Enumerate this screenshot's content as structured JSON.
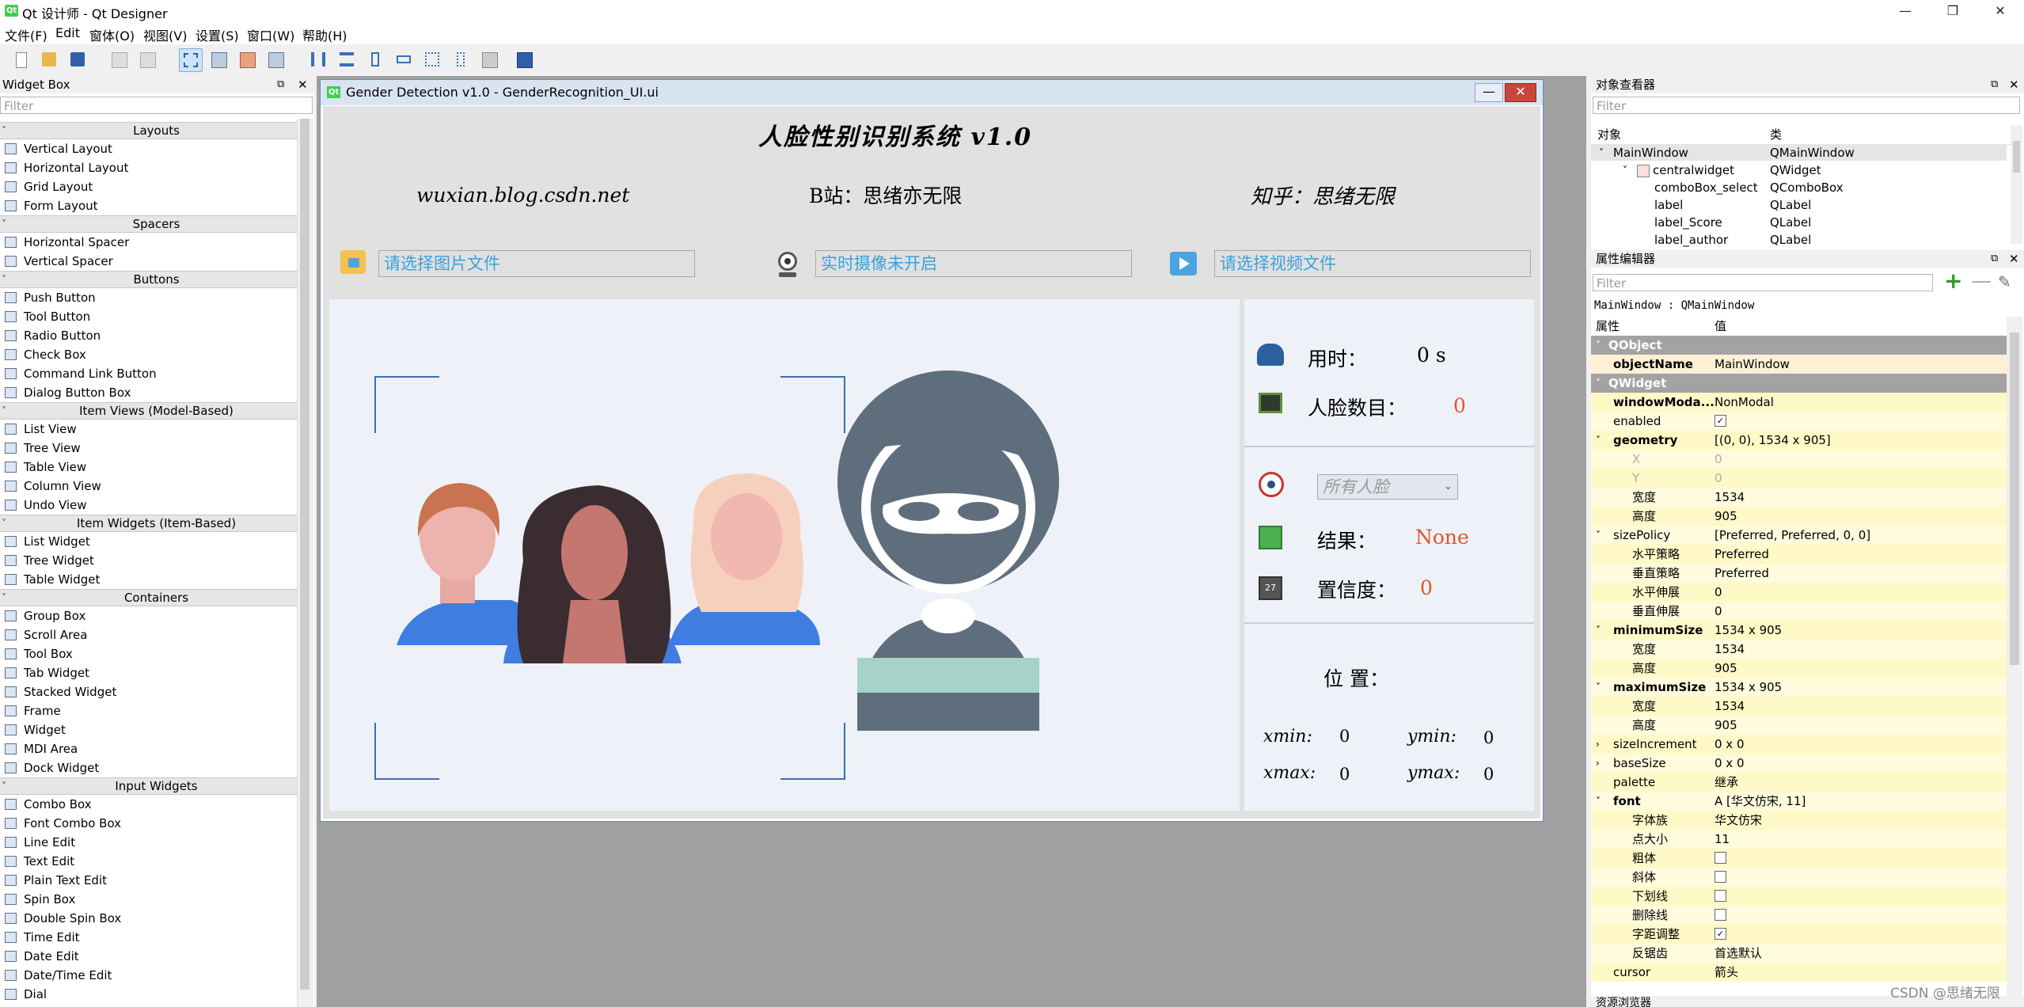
{
  "window": {
    "title": "Qt 设计师 - Qt Designer",
    "app_icon": "Qt"
  },
  "menu": [
    "文件(F)",
    "Edit",
    "窗体(O)",
    "视图(V)",
    "设置(S)",
    "窗口(W)",
    "帮助(H)"
  ],
  "widget_box": {
    "title": "Widget Box",
    "filter_placeholder": "Filter",
    "categories": {
      "layouts": {
        "label": "Layouts",
        "items": [
          "Vertical Layout",
          "Horizontal Layout",
          "Grid Layout",
          "Form Layout"
        ]
      },
      "spacers": {
        "label": "Spacers",
        "items": [
          "Horizontal Spacer",
          "Vertical Spacer"
        ]
      },
      "buttons": {
        "label": "Buttons",
        "items": [
          "Push Button",
          "Tool Button",
          "Radio Button",
          "Check Box",
          "Command Link Button",
          "Dialog Button Box"
        ]
      },
      "item_views": {
        "label": "Item Views (Model-Based)",
        "items": [
          "List View",
          "Tree View",
          "Table View",
          "Column View",
          "Undo View"
        ]
      },
      "item_widgets": {
        "label": "Item Widgets (Item-Based)",
        "items": [
          "List Widget",
          "Tree Widget",
          "Table Widget"
        ]
      },
      "containers": {
        "label": "Containers",
        "items": [
          "Group Box",
          "Scroll Area",
          "Tool Box",
          "Tab Widget",
          "Stacked Widget",
          "Frame",
          "Widget",
          "MDI Area",
          "Dock Widget"
        ]
      },
      "input_widgets": {
        "label": "Input Widgets",
        "items": [
          "Combo Box",
          "Font Combo Box",
          "Line Edit",
          "Text Edit",
          "Plain Text Edit",
          "Spin Box",
          "Double Spin Box",
          "Time Edit",
          "Date Edit",
          "Date/Time Edit",
          "Dial"
        ]
      }
    }
  },
  "form": {
    "window_title": "Gender Detection v1.0 - GenderRecognition_UI.ui",
    "heading": "人脸性别识别系统  v1.0",
    "blog": "wuxian.blog.csdn.net",
    "bilibili": "B站：思绪亦无限",
    "zhihu": "知乎：思绪无限",
    "image_input": "请选择图片文件",
    "camera_input": "实时摄像未开启",
    "video_input": "请选择视频文件",
    "time_label": "用时：",
    "time_value": "0 s",
    "faces_label": "人脸数目：",
    "faces_value": "0",
    "combo_value": "所有人脸",
    "result_label": "结果：",
    "result_value": "None",
    "confidence_label": "置信度：",
    "confidence_value": "0",
    "position_label": "位 置：",
    "xmin_label": "xmin:",
    "xmin_value": "0",
    "ymin_label": "ymin:",
    "ymin_value": "0",
    "xmax_label": "xmax:",
    "xmax_value": "0",
    "ymax_label": "ymax:",
    "ymax_value": "0"
  },
  "object_inspector": {
    "title": "对象查看器",
    "filter_placeholder": "Filter",
    "col_object": "对象",
    "col_class": "类",
    "rows": [
      {
        "name": "MainWindow",
        "cls": "QMainWindow"
      },
      {
        "name": "centralwidget",
        "cls": "QWidget"
      },
      {
        "name": "comboBox_select",
        "cls": "QComboBox"
      },
      {
        "name": "label",
        "cls": "QLabel"
      },
      {
        "name": "label_Score",
        "cls": "QLabel"
      },
      {
        "name": "label_author",
        "cls": "QLabel"
      }
    ]
  },
  "property_editor": {
    "title": "属性编辑器",
    "filter_placeholder": "Filter",
    "context": "MainWindow : QMainWindow",
    "col_prop": "属性",
    "col_value": "值",
    "rows": [
      {
        "k": "QObject",
        "v": ""
      },
      {
        "k": "objectName",
        "v": "MainWindow"
      },
      {
        "k": "QWidget",
        "v": ""
      },
      {
        "k": "windowModa...",
        "v": "NonModal"
      },
      {
        "k": "enabled",
        "v": "✓"
      },
      {
        "k": "geometry",
        "v": "[(0, 0), 1534 x 905]"
      },
      {
        "k": "X",
        "v": "0"
      },
      {
        "k": "Y",
        "v": "0"
      },
      {
        "k": "宽度",
        "v": "1534"
      },
      {
        "k": "高度",
        "v": "905"
      },
      {
        "k": "sizePolicy",
        "v": "[Preferred, Preferred, 0, 0]"
      },
      {
        "k": "水平策略",
        "v": "Preferred"
      },
      {
        "k": "垂直策略",
        "v": "Preferred"
      },
      {
        "k": "水平伸展",
        "v": "0"
      },
      {
        "k": "垂直伸展",
        "v": "0"
      },
      {
        "k": "minimumSize",
        "v": "1534 x 905"
      },
      {
        "k": "宽度",
        "v": "1534"
      },
      {
        "k": "高度",
        "v": "905"
      },
      {
        "k": "maximumSize",
        "v": "1534 x 905"
      },
      {
        "k": "宽度",
        "v": "1534"
      },
      {
        "k": "高度",
        "v": "905"
      },
      {
        "k": "sizeIncrement",
        "v": "0 x 0"
      },
      {
        "k": "baseSize",
        "v": "0 x 0"
      },
      {
        "k": "palette",
        "v": "继承"
      },
      {
        "k": "font",
        "v": "A  [华文仿宋, 11]"
      },
      {
        "k": "字体族",
        "v": "华文仿宋"
      },
      {
        "k": "点大小",
        "v": "11"
      },
      {
        "k": "粗体",
        "v": ""
      },
      {
        "k": "斜体",
        "v": ""
      },
      {
        "k": "下划线",
        "v": ""
      },
      {
        "k": "删除线",
        "v": ""
      },
      {
        "k": "字距调整",
        "v": "✓"
      },
      {
        "k": "反锯齿",
        "v": "首选默认"
      },
      {
        "k": "cursor",
        "v": "箭头"
      }
    ]
  },
  "resource_browser": {
    "title": "资源浏览器"
  },
  "watermark": "CSDN @思绪无限",
  "colors": {
    "accent_red": "#e1552f",
    "link_blue": "#3aa1d9",
    "property_group": "#a3a3a3",
    "property_yellow": "#fff9c8"
  }
}
